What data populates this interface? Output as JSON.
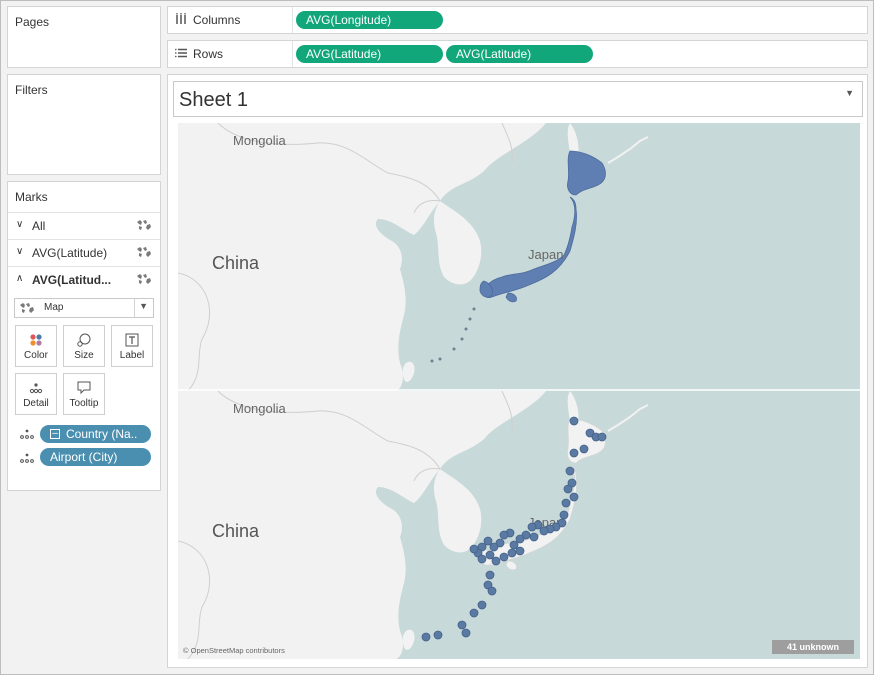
{
  "shelves": {
    "pages_label": "Pages",
    "filters_label": "Filters",
    "columns_label": "Columns",
    "rows_label": "Rows",
    "columns_pills": [
      "AVG(Longitude)"
    ],
    "rows_pills": [
      "AVG(Latitude)",
      "AVG(Latitude)"
    ]
  },
  "marks": {
    "title": "Marks",
    "cards": [
      {
        "label": "All",
        "expanded": false
      },
      {
        "label": "AVG(Latitude)",
        "expanded": false
      },
      {
        "label": "AVG(Latitud...",
        "expanded": true
      }
    ],
    "mark_type": "Map",
    "buttons": [
      "Color",
      "Size",
      "Label",
      "Detail",
      "Tooltip"
    ],
    "fields": [
      "Country (Na..",
      "Airport (City)"
    ]
  },
  "sheet": {
    "title": "Sheet 1"
  },
  "map": {
    "labels": {
      "mongolia": "Mongolia",
      "china": "China",
      "japan": "Japan"
    },
    "attribution": "© OpenStreetMap contributors",
    "unknown_badge": "41 unknown"
  },
  "colors": {
    "green_pill": "#11a77a",
    "blue_pill": "#4a8fb0",
    "ocean": "#c7d9d8",
    "land": "#f2f2f2",
    "filled_japan": "#5f7fb3",
    "airport_dot": "#5a7aa3"
  }
}
